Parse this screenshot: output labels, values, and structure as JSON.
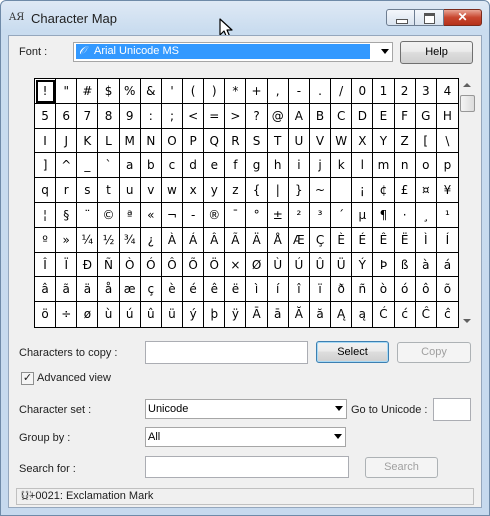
{
  "window": {
    "title": "Character Map"
  },
  "font": {
    "label": "Font :",
    "selected": "Arial Unicode MS",
    "help_label": "Help"
  },
  "grid": {
    "rows": [
      [
        "!",
        "\"",
        "#",
        "$",
        "%",
        "&",
        "'",
        "(",
        ")",
        "*",
        "+",
        ",",
        "-",
        ".",
        "/",
        "0",
        "1",
        "2",
        "3",
        "4"
      ],
      [
        "5",
        "6",
        "7",
        "8",
        "9",
        ":",
        ";",
        "<",
        "=",
        ">",
        "?",
        "@",
        "A",
        "B",
        "C",
        "D",
        "E",
        "F",
        "G",
        "H"
      ],
      [
        "I",
        "J",
        "K",
        "L",
        "M",
        "N",
        "O",
        "P",
        "Q",
        "R",
        "S",
        "T",
        "U",
        "V",
        "W",
        "X",
        "Y",
        "Z",
        "[",
        "\\"
      ],
      [
        "]",
        "^",
        "_",
        "`",
        "a",
        "b",
        "c",
        "d",
        "e",
        "f",
        "g",
        "h",
        "i",
        "j",
        "k",
        "l",
        "m",
        "n",
        "o",
        "p"
      ],
      [
        "q",
        "r",
        "s",
        "t",
        "u",
        "v",
        "w",
        "x",
        "y",
        "z",
        "{",
        "|",
        "}",
        "~",
        " ",
        "¡",
        "¢",
        "£",
        "¤",
        "¥"
      ],
      [
        "¦",
        "§",
        "¨",
        "©",
        "ª",
        "«",
        "¬",
        "-",
        "®",
        "¯",
        "°",
        "±",
        "²",
        "³",
        "´",
        "µ",
        "¶",
        "·",
        "¸",
        "¹"
      ],
      [
        "º",
        "»",
        "¼",
        "½",
        "¾",
        "¿",
        "À",
        "Á",
        "Â",
        "Ã",
        "Ä",
        "Å",
        "Æ",
        "Ç",
        "È",
        "É",
        "Ê",
        "Ë",
        "Ì",
        "Í"
      ],
      [
        "Î",
        "Ï",
        "Ð",
        "Ñ",
        "Ò",
        "Ó",
        "Ô",
        "Õ",
        "Ö",
        "×",
        "Ø",
        "Ù",
        "Ú",
        "Û",
        "Ü",
        "Ý",
        "Þ",
        "ß",
        "à",
        "á"
      ],
      [
        "â",
        "ã",
        "ä",
        "å",
        "æ",
        "ç",
        "è",
        "é",
        "ê",
        "ë",
        "ì",
        "í",
        "î",
        "ï",
        "ð",
        "ñ",
        "ò",
        "ó",
        "ô",
        "õ"
      ],
      [
        "ö",
        "÷",
        "ø",
        "ù",
        "ú",
        "û",
        "ü",
        "ý",
        "þ",
        "ÿ",
        "Ā",
        "ā",
        "Ă",
        "ă",
        "Ą",
        "ą",
        "Ć",
        "ć",
        "Ĉ",
        "ĉ"
      ]
    ],
    "selected": "!"
  },
  "copy": {
    "label": "Characters to copy :",
    "value": "",
    "select_label": "Select",
    "copy_label": "Copy"
  },
  "advanced_view": {
    "label": "Advanced view",
    "checked": true
  },
  "character_set": {
    "label": "Character set :",
    "selected": "Unicode"
  },
  "go_to_unicode": {
    "label": "Go to Unicode :",
    "value": ""
  },
  "group_by": {
    "label": "Group by :",
    "selected": "All"
  },
  "search": {
    "label": "Search for :",
    "value": "",
    "button_label": "Search"
  },
  "status_bar": {
    "text": "U+0021: Exclamation Mark"
  }
}
